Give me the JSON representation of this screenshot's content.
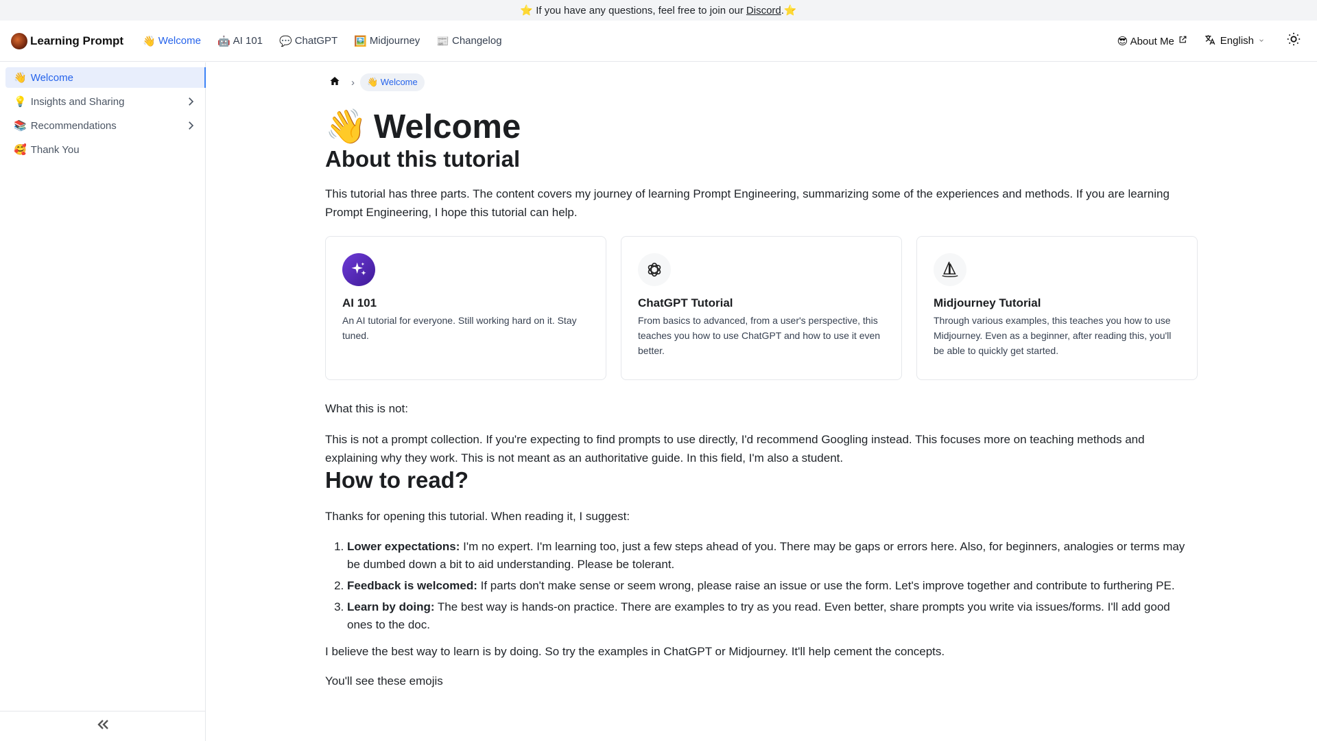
{
  "banner": {
    "text_before": "⭐️ If you have any questions, feel free to join our",
    "link": "Discord",
    "text_after": ".⭐️"
  },
  "navbar": {
    "logo_text": "Learning Prompt",
    "links": [
      {
        "emoji": "👋",
        "label": "Welcome"
      },
      {
        "emoji": "🤖",
        "label": "AI 101"
      },
      {
        "emoji": "💬",
        "label": "ChatGPT"
      },
      {
        "emoji": "🖼️",
        "label": "Midjourney"
      },
      {
        "emoji": "📰",
        "label": "Changelog"
      }
    ],
    "about_me": "😎 About Me",
    "language": "English"
  },
  "sidebar": {
    "items": [
      {
        "emoji": "👋",
        "label": "Welcome"
      },
      {
        "emoji": "💡",
        "label": "Insights and Sharing"
      },
      {
        "emoji": "📚",
        "label": "Recommendations"
      },
      {
        "emoji": "🥰",
        "label": "Thank You"
      }
    ],
    "collapse": "«"
  },
  "breadcrumb": {
    "current": "👋 Welcome"
  },
  "page": {
    "title_emoji": "👋",
    "title": "Welcome",
    "about_heading": "About this tutorial",
    "about_text": "This tutorial has three parts. The content covers my journey of learning Prompt Engineering, summarizing some of the experiences and methods. If you are learning Prompt Engineering, I hope this tutorial can help.",
    "cards": [
      {
        "title": "AI 101",
        "desc": "An AI tutorial for everyone. Still working hard on it. Stay tuned."
      },
      {
        "title": "ChatGPT Tutorial",
        "desc": "From basics to advanced, from a user's perspective, this teaches you how to use ChatGPT and how to use it even better."
      },
      {
        "title": "Midjourney Tutorial",
        "desc": "Through various examples, this teaches you how to use Midjourney. Even as a beginner, after reading this, you'll be able to quickly get started."
      }
    ],
    "not_heading": "What this is not:",
    "not_text": "This is not a prompt collection. If you're expecting to find prompts to use directly, I'd recommend Googling instead. This focuses more on teaching methods and explaining why they work. This is not meant as an authoritative guide. In this field, I'm also a student.",
    "how_heading": "How to read?",
    "how_intro": "Thanks for opening this tutorial. When reading it, I suggest:",
    "tips": [
      {
        "bold": "Lower expectations:",
        "text": " I'm no expert. I'm learning too, just a few steps ahead of you. There may be gaps or errors here. Also, for beginners, analogies or terms may be dumbed down a bit to aid understanding. Please be tolerant."
      },
      {
        "bold": "Feedback is welcomed:",
        "text": " If parts don't make sense or seem wrong, please raise an issue or use the form. Let's improve together and contribute to furthering PE."
      },
      {
        "bold": "Learn by doing:",
        "text": " The best way is hands-on practice. There are examples to try as you read. Even better, share prompts you write via issues/forms. I'll add good ones to the doc."
      }
    ],
    "believe_text": "I believe the best way to learn is by doing. So try the examples in ChatGPT or Midjourney. It'll help cement the concepts.",
    "cut_text": "You'll see these emojis"
  },
  "colors": {
    "accent": "#2563eb",
    "active_bg": "#e8eefc",
    "border": "#e5e7eb",
    "ai_icon": "#5b2bc4"
  },
  "icons": {
    "home": "home-icon",
    "chevron": "chevron-right-icon",
    "external": "external-link-icon",
    "translate": "translate-icon",
    "theme": "sun-icon",
    "collapse": "double-chevron-left-icon"
  }
}
